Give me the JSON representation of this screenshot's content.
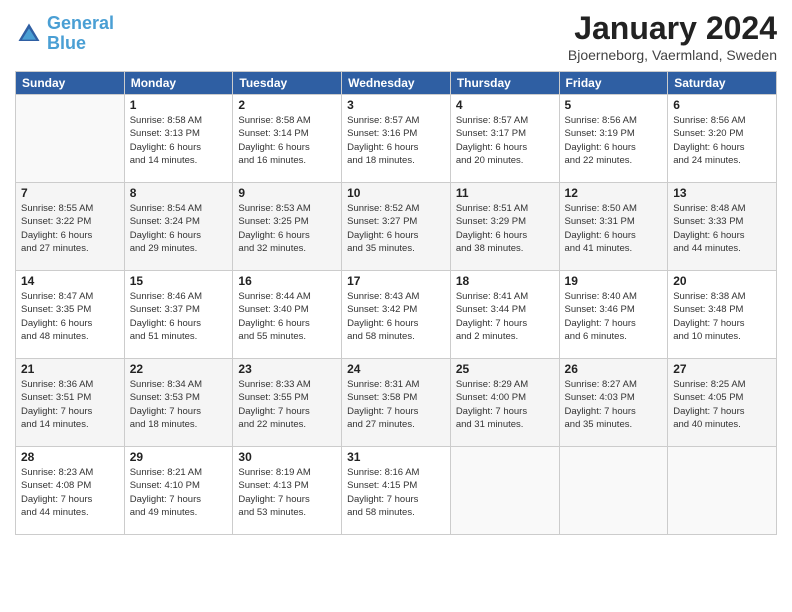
{
  "header": {
    "logo_line1": "General",
    "logo_line2": "Blue",
    "month": "January 2024",
    "location": "Bjoerneborg, Vaermland, Sweden"
  },
  "days_of_week": [
    "Sunday",
    "Monday",
    "Tuesday",
    "Wednesday",
    "Thursday",
    "Friday",
    "Saturday"
  ],
  "weeks": [
    [
      {
        "day": "",
        "info": ""
      },
      {
        "day": "1",
        "info": "Sunrise: 8:58 AM\nSunset: 3:13 PM\nDaylight: 6 hours\nand 14 minutes."
      },
      {
        "day": "2",
        "info": "Sunrise: 8:58 AM\nSunset: 3:14 PM\nDaylight: 6 hours\nand 16 minutes."
      },
      {
        "day": "3",
        "info": "Sunrise: 8:57 AM\nSunset: 3:16 PM\nDaylight: 6 hours\nand 18 minutes."
      },
      {
        "day": "4",
        "info": "Sunrise: 8:57 AM\nSunset: 3:17 PM\nDaylight: 6 hours\nand 20 minutes."
      },
      {
        "day": "5",
        "info": "Sunrise: 8:56 AM\nSunset: 3:19 PM\nDaylight: 6 hours\nand 22 minutes."
      },
      {
        "day": "6",
        "info": "Sunrise: 8:56 AM\nSunset: 3:20 PM\nDaylight: 6 hours\nand 24 minutes."
      }
    ],
    [
      {
        "day": "7",
        "info": "Sunrise: 8:55 AM\nSunset: 3:22 PM\nDaylight: 6 hours\nand 27 minutes."
      },
      {
        "day": "8",
        "info": "Sunrise: 8:54 AM\nSunset: 3:24 PM\nDaylight: 6 hours\nand 29 minutes."
      },
      {
        "day": "9",
        "info": "Sunrise: 8:53 AM\nSunset: 3:25 PM\nDaylight: 6 hours\nand 32 minutes."
      },
      {
        "day": "10",
        "info": "Sunrise: 8:52 AM\nSunset: 3:27 PM\nDaylight: 6 hours\nand 35 minutes."
      },
      {
        "day": "11",
        "info": "Sunrise: 8:51 AM\nSunset: 3:29 PM\nDaylight: 6 hours\nand 38 minutes."
      },
      {
        "day": "12",
        "info": "Sunrise: 8:50 AM\nSunset: 3:31 PM\nDaylight: 6 hours\nand 41 minutes."
      },
      {
        "day": "13",
        "info": "Sunrise: 8:48 AM\nSunset: 3:33 PM\nDaylight: 6 hours\nand 44 minutes."
      }
    ],
    [
      {
        "day": "14",
        "info": "Sunrise: 8:47 AM\nSunset: 3:35 PM\nDaylight: 6 hours\nand 48 minutes."
      },
      {
        "day": "15",
        "info": "Sunrise: 8:46 AM\nSunset: 3:37 PM\nDaylight: 6 hours\nand 51 minutes."
      },
      {
        "day": "16",
        "info": "Sunrise: 8:44 AM\nSunset: 3:40 PM\nDaylight: 6 hours\nand 55 minutes."
      },
      {
        "day": "17",
        "info": "Sunrise: 8:43 AM\nSunset: 3:42 PM\nDaylight: 6 hours\nand 58 minutes."
      },
      {
        "day": "18",
        "info": "Sunrise: 8:41 AM\nSunset: 3:44 PM\nDaylight: 7 hours\nand 2 minutes."
      },
      {
        "day": "19",
        "info": "Sunrise: 8:40 AM\nSunset: 3:46 PM\nDaylight: 7 hours\nand 6 minutes."
      },
      {
        "day": "20",
        "info": "Sunrise: 8:38 AM\nSunset: 3:48 PM\nDaylight: 7 hours\nand 10 minutes."
      }
    ],
    [
      {
        "day": "21",
        "info": "Sunrise: 8:36 AM\nSunset: 3:51 PM\nDaylight: 7 hours\nand 14 minutes."
      },
      {
        "day": "22",
        "info": "Sunrise: 8:34 AM\nSunset: 3:53 PM\nDaylight: 7 hours\nand 18 minutes."
      },
      {
        "day": "23",
        "info": "Sunrise: 8:33 AM\nSunset: 3:55 PM\nDaylight: 7 hours\nand 22 minutes."
      },
      {
        "day": "24",
        "info": "Sunrise: 8:31 AM\nSunset: 3:58 PM\nDaylight: 7 hours\nand 27 minutes."
      },
      {
        "day": "25",
        "info": "Sunrise: 8:29 AM\nSunset: 4:00 PM\nDaylight: 7 hours\nand 31 minutes."
      },
      {
        "day": "26",
        "info": "Sunrise: 8:27 AM\nSunset: 4:03 PM\nDaylight: 7 hours\nand 35 minutes."
      },
      {
        "day": "27",
        "info": "Sunrise: 8:25 AM\nSunset: 4:05 PM\nDaylight: 7 hours\nand 40 minutes."
      }
    ],
    [
      {
        "day": "28",
        "info": "Sunrise: 8:23 AM\nSunset: 4:08 PM\nDaylight: 7 hours\nand 44 minutes."
      },
      {
        "day": "29",
        "info": "Sunrise: 8:21 AM\nSunset: 4:10 PM\nDaylight: 7 hours\nand 49 minutes."
      },
      {
        "day": "30",
        "info": "Sunrise: 8:19 AM\nSunset: 4:13 PM\nDaylight: 7 hours\nand 53 minutes."
      },
      {
        "day": "31",
        "info": "Sunrise: 8:16 AM\nSunset: 4:15 PM\nDaylight: 7 hours\nand 58 minutes."
      },
      {
        "day": "",
        "info": ""
      },
      {
        "day": "",
        "info": ""
      },
      {
        "day": "",
        "info": ""
      }
    ]
  ]
}
